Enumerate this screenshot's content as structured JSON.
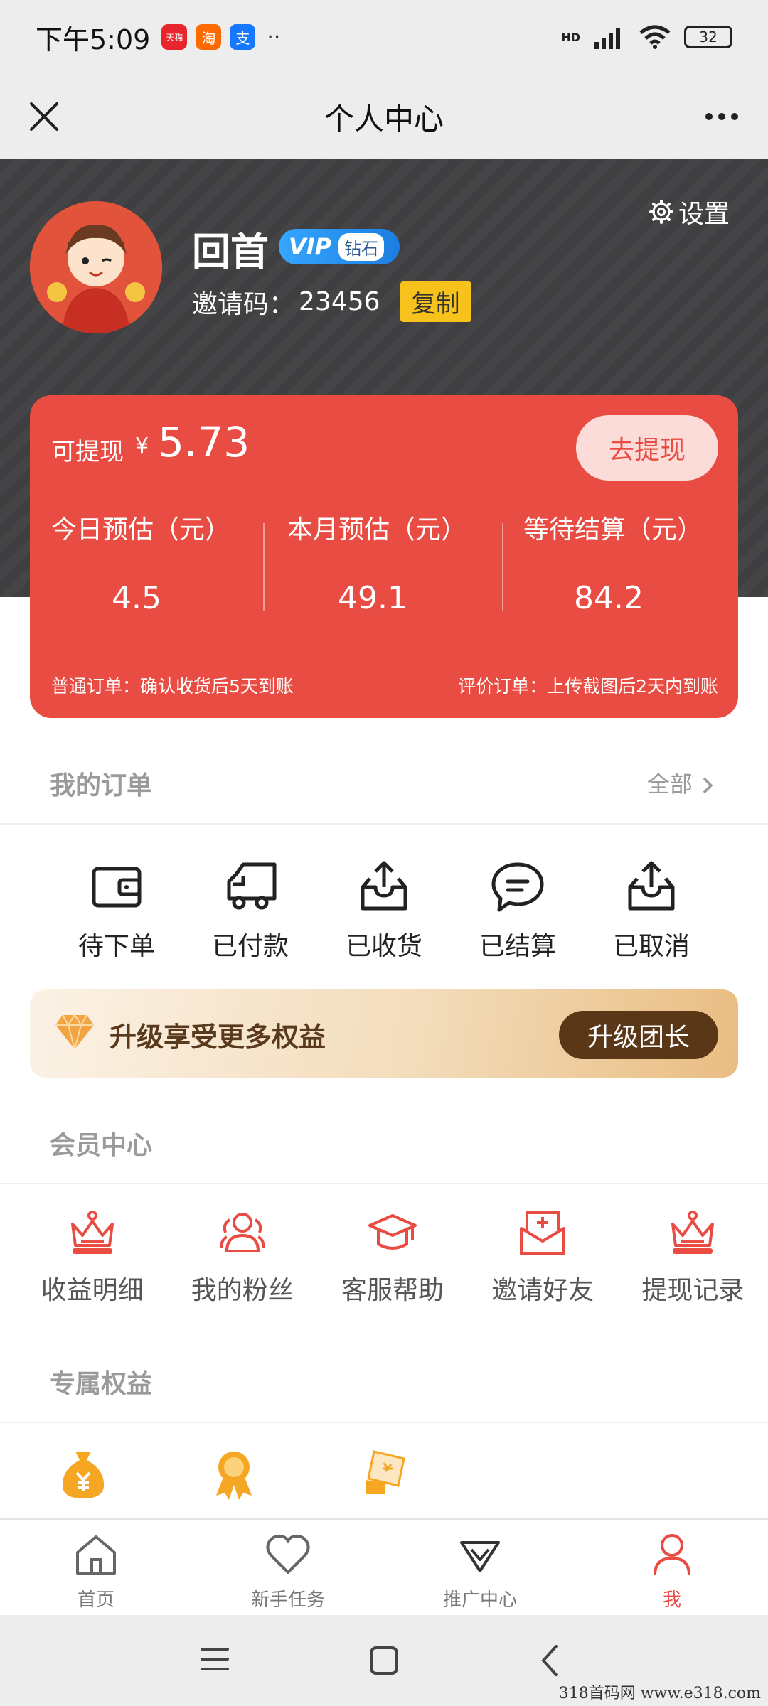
{
  "status_bar": {
    "time": "下午5:09",
    "apps": [
      "天猫",
      "淘",
      "支"
    ],
    "dots": "··",
    "network": "HD",
    "battery": "32"
  },
  "nav": {
    "title": "个人中心"
  },
  "profile": {
    "name": "回首",
    "vip": "VIP",
    "level": "钻石",
    "invite_label": "邀请码：",
    "invite_code": "23456",
    "copy": "复制",
    "settings": "设置"
  },
  "earnings": {
    "withdraw_label": "可提现",
    "currency": "¥",
    "withdraw_amount": "5.73",
    "withdraw_button": "去提现",
    "stats": [
      {
        "label": "今日预估（元）",
        "value": "4.5"
      },
      {
        "label": "本月预估（元）",
        "value": "49.1"
      },
      {
        "label": "等待结算（元）",
        "value": "84.2"
      }
    ],
    "note_left": "普通订单：确认收货后5天到账",
    "note_right": "评价订单：上传截图后2天内到账"
  },
  "orders": {
    "title": "我的订单",
    "all": "全部",
    "items": [
      {
        "label": "待下单",
        "icon": "wallet-icon"
      },
      {
        "label": "已付款",
        "icon": "truck-icon"
      },
      {
        "label": "已收货",
        "icon": "inbox-icon"
      },
      {
        "label": "已结算",
        "icon": "chat-icon"
      },
      {
        "label": "已取消",
        "icon": "inbox-upload-icon"
      }
    ]
  },
  "upgrade": {
    "text": "升级享受更多权益",
    "button": "升级团长"
  },
  "member": {
    "title": "会员中心",
    "items": [
      {
        "label": "收益明细",
        "icon": "crown-icon"
      },
      {
        "label": "我的粉丝",
        "icon": "users-icon"
      },
      {
        "label": "客服帮助",
        "icon": "graduation-cap-icon"
      },
      {
        "label": "邀请好友",
        "icon": "mail-icon"
      },
      {
        "label": "提现记录",
        "icon": "crown-icon"
      }
    ]
  },
  "benefits": {
    "title": "专属权益",
    "items": [
      {
        "icon": "money-bag-icon"
      },
      {
        "icon": "medal-icon"
      },
      {
        "icon": "coupon-icon"
      }
    ]
  },
  "tabs": [
    {
      "label": "首页",
      "icon": "home-icon",
      "active": false
    },
    {
      "label": "新手任务",
      "icon": "heart-icon",
      "active": false
    },
    {
      "label": "推广中心",
      "icon": "diamond-icon",
      "active": false
    },
    {
      "label": "我",
      "icon": "user-icon",
      "active": true
    }
  ],
  "watermark": "318首码网  www.e318.com",
  "colors": {
    "accent": "#e84c43",
    "header_bg": "#3b3b3d",
    "copy_btn": "#f7c21b",
    "vip": "#1b7ee0",
    "upgrade_btn": "#5a3717"
  }
}
